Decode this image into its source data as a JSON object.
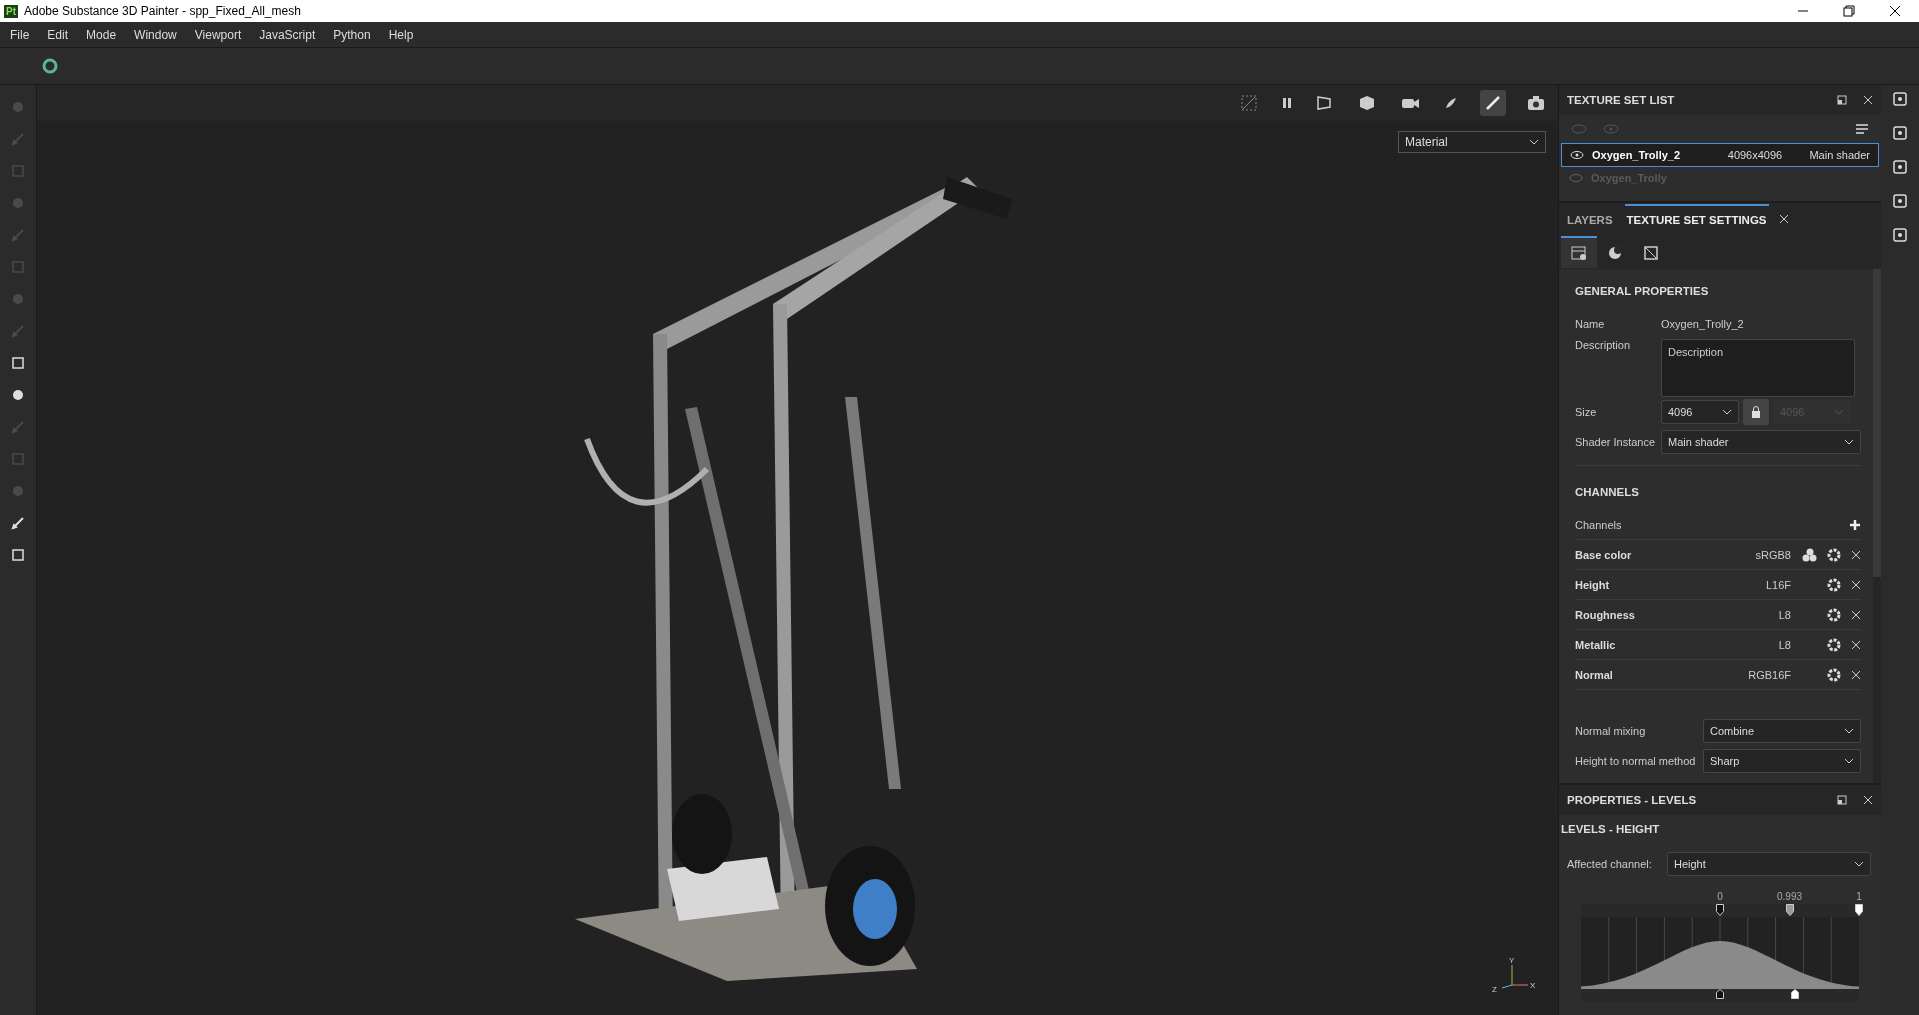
{
  "window": {
    "title": "Adobe Substance 3D Painter - spp_Fixed_All_mesh",
    "app_badge": "Pt"
  },
  "menu": [
    "File",
    "Edit",
    "Mode",
    "Window",
    "Viewport",
    "JavaScript",
    "Python",
    "Help"
  ],
  "viewport": {
    "mode_dropdown": "Material",
    "axis_labels": [
      "Y",
      "Z",
      "X"
    ]
  },
  "texture_set_list": {
    "title": "TEXTURE SET LIST",
    "rows": [
      {
        "name": "Oxygen_Trolly_2",
        "size": "4096x4096",
        "shader": "Main shader",
        "selected": true,
        "enabled": true
      },
      {
        "name": "Oxygen_Trolly",
        "size": "",
        "shader": "",
        "selected": false,
        "enabled": false
      }
    ]
  },
  "tabs": [
    {
      "label": "LAYERS",
      "selected": false
    },
    {
      "label": "TEXTURE SET SETTINGS",
      "selected": true
    }
  ],
  "subtabs": [
    {
      "selected": true
    },
    {
      "selected": false
    },
    {
      "selected": false
    }
  ],
  "general": {
    "title": "GENERAL PROPERTIES",
    "name_label": "Name",
    "name": "Oxygen_Trolly_2",
    "description_label": "Description",
    "description_placeholder": "Description",
    "size_label": "Size",
    "size": "4096",
    "size_linked": "4096",
    "shader_label": "Shader Instance",
    "shader": "Main shader"
  },
  "channels": {
    "title": "CHANNELS",
    "label": "Channels",
    "rows": [
      {
        "name": "Base color",
        "format": "sRGB8",
        "kind": "color"
      },
      {
        "name": "Height",
        "format": "L16F",
        "kind": "scalar"
      },
      {
        "name": "Roughness",
        "format": "L8",
        "kind": "scalar"
      },
      {
        "name": "Metallic",
        "format": "L8",
        "kind": "scalar"
      },
      {
        "name": "Normal",
        "format": "RGB16F",
        "kind": "scalar"
      }
    ],
    "normal_mixing_label": "Normal mixing",
    "normal_mixing": "Combine",
    "height_method_label": "Height to normal method",
    "height_method": "Sharp"
  },
  "levels": {
    "panel_title": "PROPERTIES - LEVELS",
    "title": "LEVELS - HEIGHT",
    "channel_label": "Affected channel:",
    "channel": "Height",
    "input_handles": [
      {
        "label": "0",
        "level": 0.5
      },
      {
        "label": "0.993",
        "level": 0.75
      },
      {
        "label": "1",
        "level": 1.0
      }
    ],
    "output_handles": [
      {
        "level": 0.5
      },
      {
        "level": 0.77
      }
    ]
  }
}
